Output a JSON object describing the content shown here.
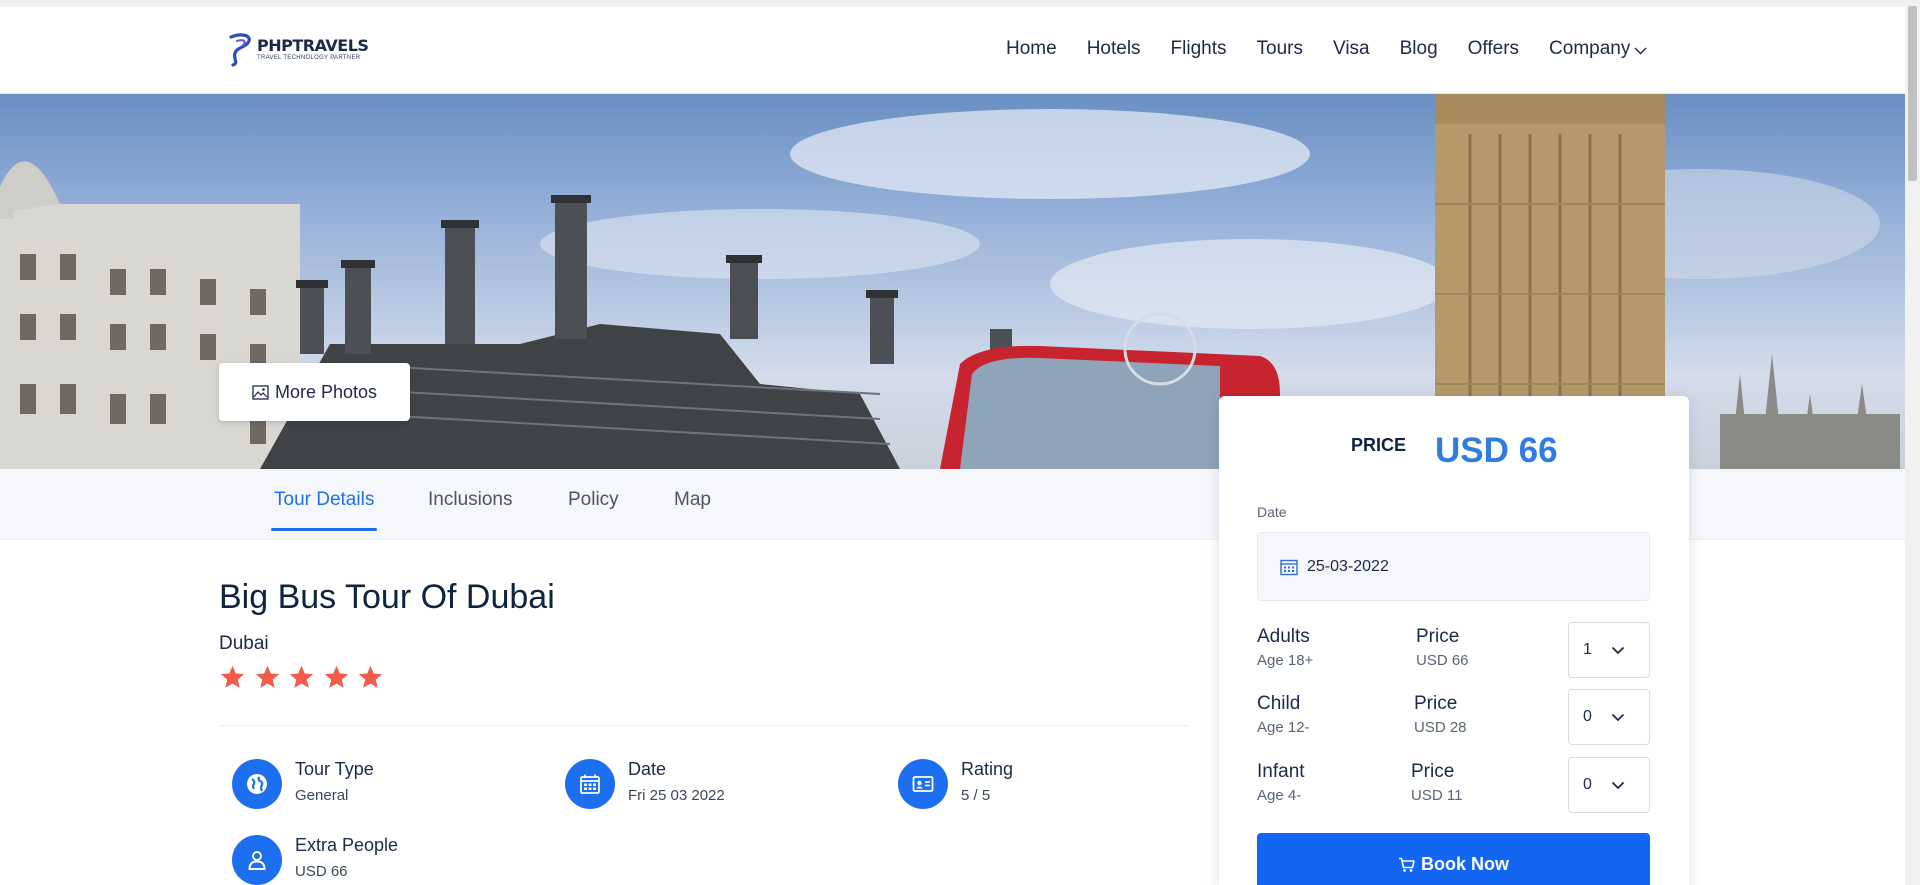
{
  "brand": {
    "name": "PHPTRAVELS",
    "tagline": "TRAVEL TECHNOLOGY PARTNER"
  },
  "nav": {
    "items": [
      "Home",
      "Hotels",
      "Flights",
      "Tours",
      "Visa",
      "Blog",
      "Offers",
      "Company"
    ]
  },
  "hero": {
    "more_photos_label": "More Photos"
  },
  "tabs": [
    "Tour Details",
    "Inclusions",
    "Policy",
    "Map"
  ],
  "tour": {
    "title": "Big Bus Tour Of Dubai",
    "city": "Dubai",
    "stars": 5,
    "features": [
      {
        "label": "Tour Type",
        "value": "General",
        "icon": "globe-icon"
      },
      {
        "label": "Date",
        "value": "Fri 25 03 2022",
        "icon": "calendar-icon"
      },
      {
        "label": "Rating",
        "value": "5 / 5",
        "icon": "id-card-icon"
      },
      {
        "label": "Extra People",
        "value": "USD 66",
        "icon": "user-icon"
      }
    ]
  },
  "booking": {
    "price_label": "PRICE",
    "price_value": "USD 66",
    "date_label": "Date",
    "date_value": "25-03-2022",
    "rows": [
      {
        "name": "Adults",
        "age": "Age 18+",
        "price_label": "Price",
        "price": "USD 66",
        "qty": "1"
      },
      {
        "name": "Child",
        "age": "Age 12-",
        "price_label": "Price",
        "price": "USD 28",
        "qty": "0"
      },
      {
        "name": "Infant",
        "age": "Age 4-",
        "price_label": "Price",
        "price": "USD 11",
        "qty": "0"
      }
    ],
    "book_label": "Book Now"
  },
  "colors": {
    "accent": "#1266f1",
    "price": "#2f7de1",
    "star": "#f25c4b"
  }
}
